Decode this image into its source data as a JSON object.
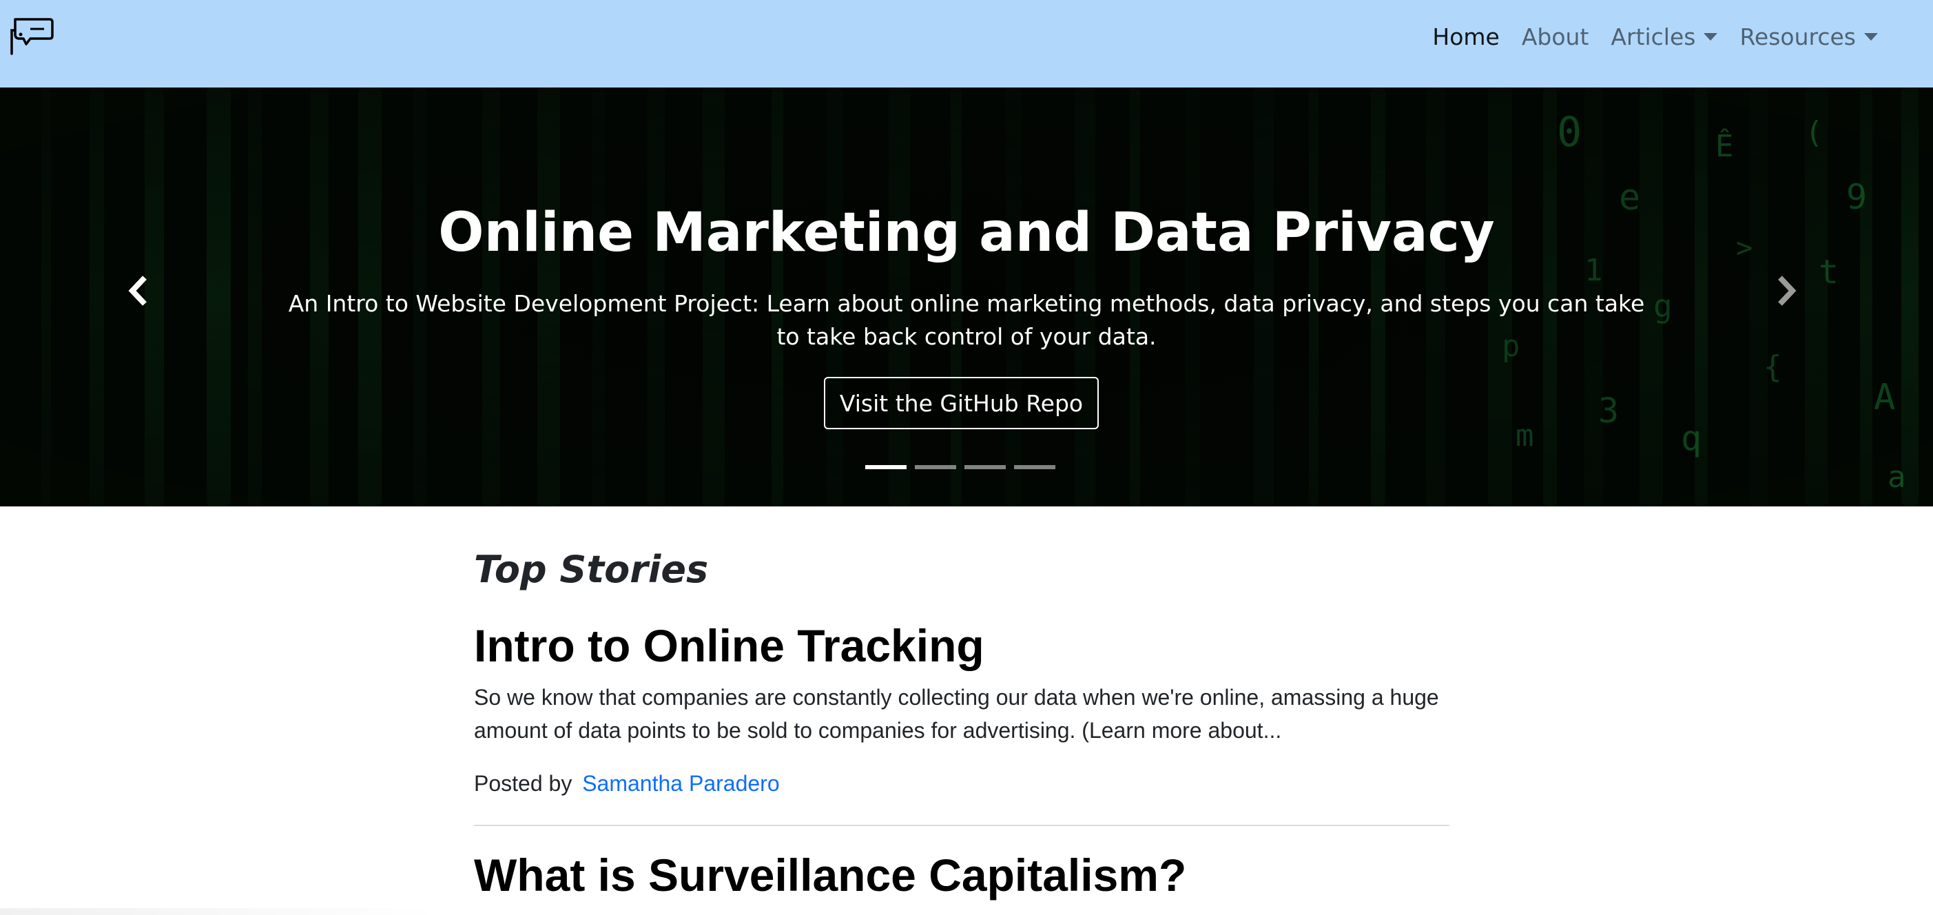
{
  "navbar": {
    "logo": "security-camera-icon",
    "links": [
      {
        "label": "Home",
        "active": true,
        "dropdown": false
      },
      {
        "label": "About",
        "active": false,
        "dropdown": false
      },
      {
        "label": "Articles",
        "active": false,
        "dropdown": true
      },
      {
        "label": "Resources",
        "active": false,
        "dropdown": true
      }
    ],
    "background": "#b1d8fb"
  },
  "hero": {
    "title": "Online Marketing and Data Privacy",
    "subtitle": "An Intro to Website Development Project: Learn about online marketing methods, data privacy, and steps you can take to take back control of your data.",
    "button_label": "Visit the GitHub Repo",
    "prev_icon": "chevron-left-icon",
    "next_icon": "chevron-right-icon",
    "slides": 4,
    "active_slide": 1
  },
  "main": {
    "section_heading": "Top Stories",
    "posts": [
      {
        "title": "Intro to Online Tracking",
        "excerpt": "So we know that companies are constantly collecting our data when we're online, amassing a huge amount of data points to be sold to companies for advertising. (Learn more about...",
        "meta_prefix": "Posted by",
        "author": "Samantha Paradero"
      },
      {
        "title": "What is Surveillance Capitalism?"
      }
    ]
  },
  "colors": {
    "link": "#0d6efd",
    "hero_background": "#020702",
    "matrix_green": "#28c85a"
  }
}
